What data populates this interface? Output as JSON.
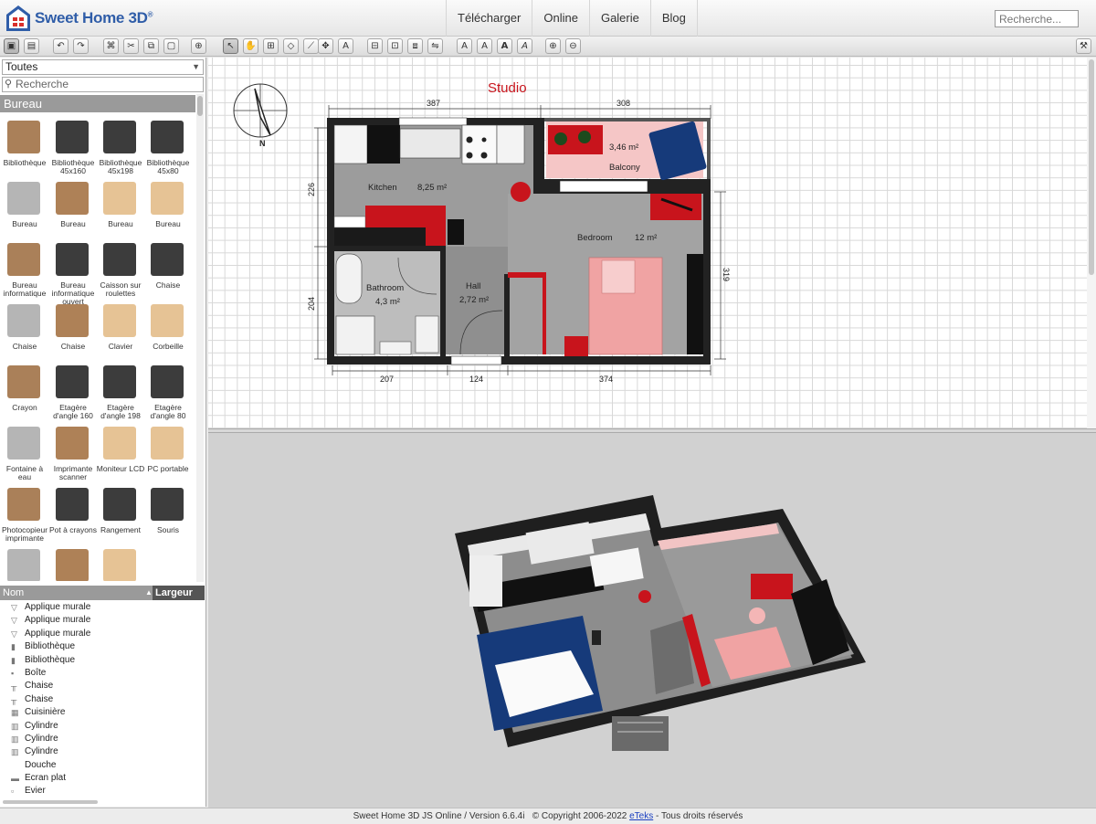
{
  "header": {
    "logo_text": "Sweet Home 3D",
    "logo_trademark": "®",
    "nav": [
      "Télécharger",
      "Online",
      "Galerie",
      "Blog"
    ],
    "search_placeholder": "Recherche..."
  },
  "toolbar": {
    "buttons": [
      "plan-3d-toggle-icon",
      "aerial-view-icon",
      "undo-icon",
      "redo-icon",
      "cut-furniture-icon",
      "cut-icon",
      "copy-icon",
      "paste-icon",
      "add-furniture-icon",
      "select-mode-icon",
      "pan-mode-icon",
      "create-walls-icon",
      "create-rooms-icon",
      "create-polylines-icon",
      "create-dimensions-icon",
      "add-text-icon",
      "group-icon",
      "ungroup-icon",
      "duplicate-icon",
      "mirror-icon",
      "increase-text-icon",
      "decrease-text-icon",
      "bold-text-icon",
      "italic-text-icon",
      "zoom-in-icon",
      "zoom-out-icon",
      "preferences-icon"
    ]
  },
  "catalog": {
    "category_select": "Toutes",
    "search_placeholder": "Recherche",
    "category_header": "Bureau",
    "items": [
      {
        "label": "Bibliothèque",
        "icon": "bookcase-icon"
      },
      {
        "label": "Bibliothèque 45x160",
        "icon": "tall-bookcase-icon"
      },
      {
        "label": "Bibliothèque 45x198",
        "icon": "tall-bookcase-icon"
      },
      {
        "label": "Bibliothèque 45x80",
        "icon": "low-bookcase-icon"
      },
      {
        "label": "Bureau",
        "icon": "desk-grey-icon"
      },
      {
        "label": "Bureau",
        "icon": "desk-wood-icon"
      },
      {
        "label": "Bureau",
        "icon": "desk-light-icon"
      },
      {
        "label": "Bureau",
        "icon": "desk-corner-icon"
      },
      {
        "label": "Bureau informatique",
        "icon": "computer-desk-icon"
      },
      {
        "label": "Bureau informatique ouvert",
        "icon": "open-computer-desk-icon"
      },
      {
        "label": "Caisson sur roulettes",
        "icon": "drawer-unit-icon"
      },
      {
        "label": "Chaise",
        "icon": "blue-chair-icon"
      },
      {
        "label": "Chaise",
        "icon": "red-chair-icon"
      },
      {
        "label": "Chaise",
        "icon": "office-chair-icon"
      },
      {
        "label": "Clavier",
        "icon": "keyboard-icon"
      },
      {
        "label": "Corbeille",
        "icon": "waste-basket-icon"
      },
      {
        "label": "Crayon",
        "icon": "pencil-icon"
      },
      {
        "label": "Etagère d'angle 160",
        "icon": "corner-shelf-icon"
      },
      {
        "label": "Etagère d'angle 198",
        "icon": "corner-shelf-icon"
      },
      {
        "label": "Etagère d'angle 80",
        "icon": "corner-shelf-low-icon"
      },
      {
        "label": "Fontaine à eau",
        "icon": "water-fountain-icon"
      },
      {
        "label": "Imprimante scanner",
        "icon": "printer-icon"
      },
      {
        "label": "Moniteur LCD",
        "icon": "monitor-icon"
      },
      {
        "label": "PC portable",
        "icon": "laptop-icon"
      },
      {
        "label": "Photocopieur imprimante",
        "icon": "photocopier-icon"
      },
      {
        "label": "Pot à crayons",
        "icon": "pencil-pot-icon"
      },
      {
        "label": "Rangement",
        "icon": "storage-icon"
      },
      {
        "label": "Souris",
        "icon": "mouse-icon"
      },
      {
        "label": "",
        "icon": "board-icon"
      },
      {
        "label": "",
        "icon": "phone-icon"
      },
      {
        "label": "",
        "icon": "box-icon"
      }
    ]
  },
  "furniture_list": {
    "col_name": "Nom",
    "col_width": "Largeur",
    "rows": [
      {
        "name": "Applique murale",
        "icon": "wall-lamp-icon"
      },
      {
        "name": "Applique murale",
        "icon": "wall-lamp-icon"
      },
      {
        "name": "Applique murale",
        "icon": "wall-lamp-icon"
      },
      {
        "name": "Bibliothèque",
        "icon": "bookcase-icon"
      },
      {
        "name": "Bibliothèque",
        "icon": "bookcase-icon"
      },
      {
        "name": "Boîte",
        "icon": "box-icon"
      },
      {
        "name": "Chaise",
        "icon": "chair-icon"
      },
      {
        "name": "Chaise",
        "icon": "chair-icon"
      },
      {
        "name": "Cuisinière",
        "icon": "cooker-icon"
      },
      {
        "name": "Cylindre",
        "icon": "cylinder-icon"
      },
      {
        "name": "Cylindre",
        "icon": "cylinder-icon"
      },
      {
        "name": "Cylindre",
        "icon": "cylinder-icon"
      },
      {
        "name": "Douche",
        "icon": "shower-icon"
      },
      {
        "name": "Ecran plat",
        "icon": "flat-screen-icon"
      },
      {
        "name": "Evier",
        "icon": "sink-icon"
      }
    ]
  },
  "plan": {
    "title": "Studio",
    "rooms": {
      "kitchen": {
        "name": "Kitchen",
        "area": "8,25 m²"
      },
      "balcony": {
        "name": "Balcony",
        "area": "3,46 m²"
      },
      "bedroom": {
        "name": "Bedroom",
        "area": "12 m²"
      },
      "bathroom": {
        "name": "Bathroom",
        "area": "4,3 m²"
      },
      "hall": {
        "name": "Hall",
        "area": "2,72 m²"
      }
    },
    "dimensions": {
      "top_left": "387",
      "top_right": "308",
      "left_top": "226",
      "left_bottom": "204",
      "right": "319",
      "bottom_left": "207",
      "bottom_mid": "124",
      "bottom_right": "374"
    },
    "compass_letter": "N"
  },
  "footer": {
    "text": "Sweet Home 3D JS Online / Version 6.6.4i",
    "copyright": "© Copyright 2006-2022",
    "link": "eTeks",
    "rights": "- Tous droits réservés"
  },
  "colors": {
    "accent_red": "#c8141c",
    "balcony_pink": "#f5c6c6",
    "bed_pink": "#f0a3a3",
    "floor_grey": "#9c9c9c",
    "wall": "#222222",
    "navy": "#163a7a"
  }
}
